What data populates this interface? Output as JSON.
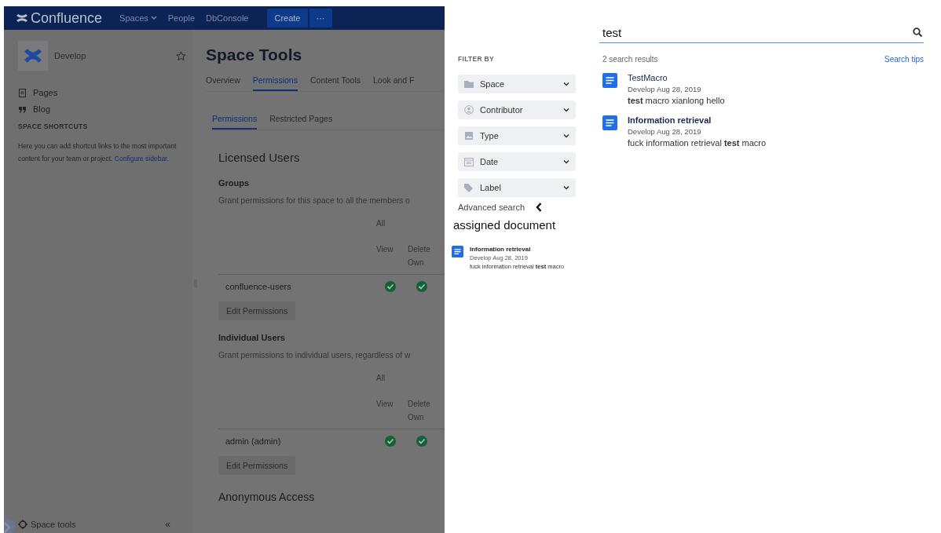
{
  "nav": {
    "logo": "Confluence",
    "items": [
      {
        "label": "Spaces",
        "dropdown": true
      },
      {
        "label": "People",
        "dropdown": false
      },
      {
        "label": "DbConsole",
        "dropdown": false
      }
    ],
    "create": "Create",
    "more": "···"
  },
  "sidebar": {
    "space_name": "Develop",
    "items": [
      {
        "kind": "pages",
        "label": "Pages"
      },
      {
        "kind": "blog",
        "label": "Blog"
      }
    ],
    "shortcuts_heading": "SPACE SHORTCUTS",
    "shortcuts_text": "Here you can add shortcut links to the most important content for your team or project.",
    "shortcuts_link": "Configure sidebar",
    "shortcuts_end": ".",
    "footer": "Space tools",
    "collapse": "«"
  },
  "main": {
    "title": "Space Tools",
    "tabs": [
      {
        "label": "Overview",
        "selected": false
      },
      {
        "label": "Permissions",
        "selected": true
      },
      {
        "label": "Content Tools",
        "selected": false
      },
      {
        "label": "Look and F",
        "selected": false
      }
    ],
    "subtabs": [
      {
        "label": "Permissions",
        "selected": true
      },
      {
        "label": "Restricted Pages",
        "selected": false
      }
    ],
    "section_title": "Licensed Users",
    "groups": [
      {
        "heading": "Groups",
        "description": "Grant permissions for this space to all the members o",
        "group_header": "All",
        "columns": [
          "View",
          "Delete Own"
        ],
        "rows": [
          {
            "name": "confluence-users",
            "granted": [
              true,
              true
            ]
          }
        ],
        "button": "Edit Permissions"
      },
      {
        "heading": "Individual Users",
        "description": "Grant permissions to individual users, regardless of w",
        "group_header": "All",
        "columns": [
          "View",
          "Delete Own"
        ],
        "rows": [
          {
            "name": "admin (admin)",
            "granted": [
              true,
              true
            ]
          }
        ],
        "button": "Edit Permissions"
      }
    ],
    "next_section": "Anonymous Access"
  },
  "search": {
    "value": "test",
    "filter_heading": "FILTER BY",
    "filters": [
      {
        "kind": "folder",
        "label": "Space"
      },
      {
        "kind": "person",
        "label": "Contributor"
      },
      {
        "kind": "image",
        "label": "Type"
      },
      {
        "kind": "calendar",
        "label": "Date"
      },
      {
        "kind": "tag",
        "label": "Label"
      }
    ],
    "advanced": "Advanced search",
    "assigned_heading": "assigned document",
    "assigned": [
      {
        "title": "Information retrieval",
        "space": "Develop",
        "date": "Aug 28, 2019",
        "excerpt": "fuck information retrieval **test** macro"
      }
    ],
    "count": "2 search results",
    "tips": "Search tips",
    "results": [
      {
        "title": "TestMacro",
        "space": "Develop",
        "date": "Aug 28, 2019",
        "excerpt": "**test** macro xianlong hello"
      },
      {
        "title": "Information retrieval",
        "space": "Develop",
        "date": "Aug 28, 2019",
        "excerpt": "fuck information retrieval **test** macro"
      }
    ]
  }
}
